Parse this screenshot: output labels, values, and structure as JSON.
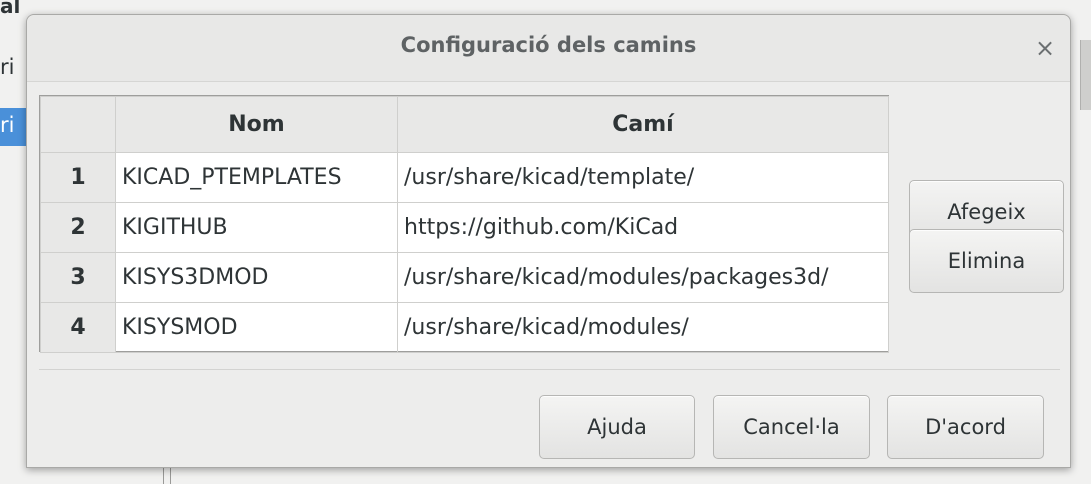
{
  "background": {
    "text_top": "al",
    "text_mid": "ri",
    "text_selected": "ri"
  },
  "dialog": {
    "title": "Configuració dels camins",
    "close_glyph": "×"
  },
  "table": {
    "columns": [
      "Nom",
      "Camí"
    ],
    "rows": [
      {
        "index": "1",
        "name": "KICAD_PTEMPLATES",
        "path": "/usr/share/kicad/template/"
      },
      {
        "index": "2",
        "name": "KIGITHUB",
        "path": "https://github.com/KiCad"
      },
      {
        "index": "3",
        "name": "KISYS3DMOD",
        "path": "/usr/share/kicad/modules/packages3d/"
      },
      {
        "index": "4",
        "name": "KISYSMOD",
        "path": "/usr/share/kicad/modules/"
      }
    ]
  },
  "buttons": {
    "add": "Afegeix",
    "delete": "Elimina",
    "help": "Ajuda",
    "cancel": "Cancel·la",
    "ok": "D'acord"
  }
}
